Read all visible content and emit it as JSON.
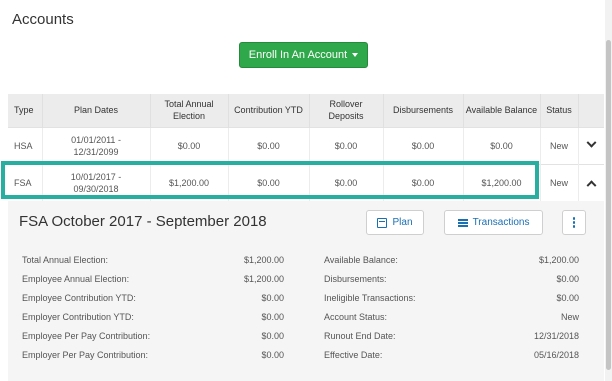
{
  "page": {
    "title": "Accounts"
  },
  "enroll_button": {
    "label": "Enroll In An Account"
  },
  "table": {
    "headers": [
      "Type",
      "Plan Dates",
      "Total Annual Election",
      "Contribution YTD",
      "Rollover Deposits",
      "Disbursements",
      "Available Balance",
      "Status"
    ],
    "rows": [
      {
        "type": "HSA",
        "plan_start": "01/01/2011 -",
        "plan_end": "12/31/2099",
        "total_annual_election": "$0.00",
        "contribution_ytd": "$0.00",
        "rollover_deposits": "$0.00",
        "disbursements": "$0.00",
        "available_balance": "$0.00",
        "status": "New",
        "expanded": false
      },
      {
        "type": "FSA",
        "plan_start": "10/01/2017 -",
        "plan_end": "09/30/2018",
        "total_annual_election": "$1,200.00",
        "contribution_ytd": "$0.00",
        "rollover_deposits": "$0.00",
        "disbursements": "$0.00",
        "available_balance": "$1,200.00",
        "status": "New",
        "expanded": true
      }
    ]
  },
  "detail": {
    "title": "FSA October 2017 - September 2018",
    "plan_button": "Plan",
    "transactions_button": "Transactions",
    "left": [
      {
        "label": "Total Annual Election:",
        "value": "$1,200.00"
      },
      {
        "label": "Employee Annual Election:",
        "value": "$1,200.00"
      },
      {
        "label": "Employee Contribution YTD:",
        "value": "$0.00"
      },
      {
        "label": "Employer Contribution YTD:",
        "value": "$0.00"
      },
      {
        "label": "Employee Per Pay Contribution:",
        "value": "$0.00"
      },
      {
        "label": "Employer Per Pay Contribution:",
        "value": "$0.00"
      }
    ],
    "right": [
      {
        "label": "Available Balance:",
        "value": "$1,200.00"
      },
      {
        "label": "Disbursements:",
        "value": "$0.00"
      },
      {
        "label": "Ineligible Transactions:",
        "value": "$0.00"
      },
      {
        "label": "Account Status:",
        "value": "New"
      },
      {
        "label": "Runout End Date:",
        "value": "12/31/2018"
      },
      {
        "label": "Effective Date:",
        "value": "05/16/2018"
      }
    ]
  },
  "colors": {
    "accent_green": "#2ea84a",
    "highlight_teal": "#28aea0",
    "link_blue": "#1a6fb3"
  }
}
